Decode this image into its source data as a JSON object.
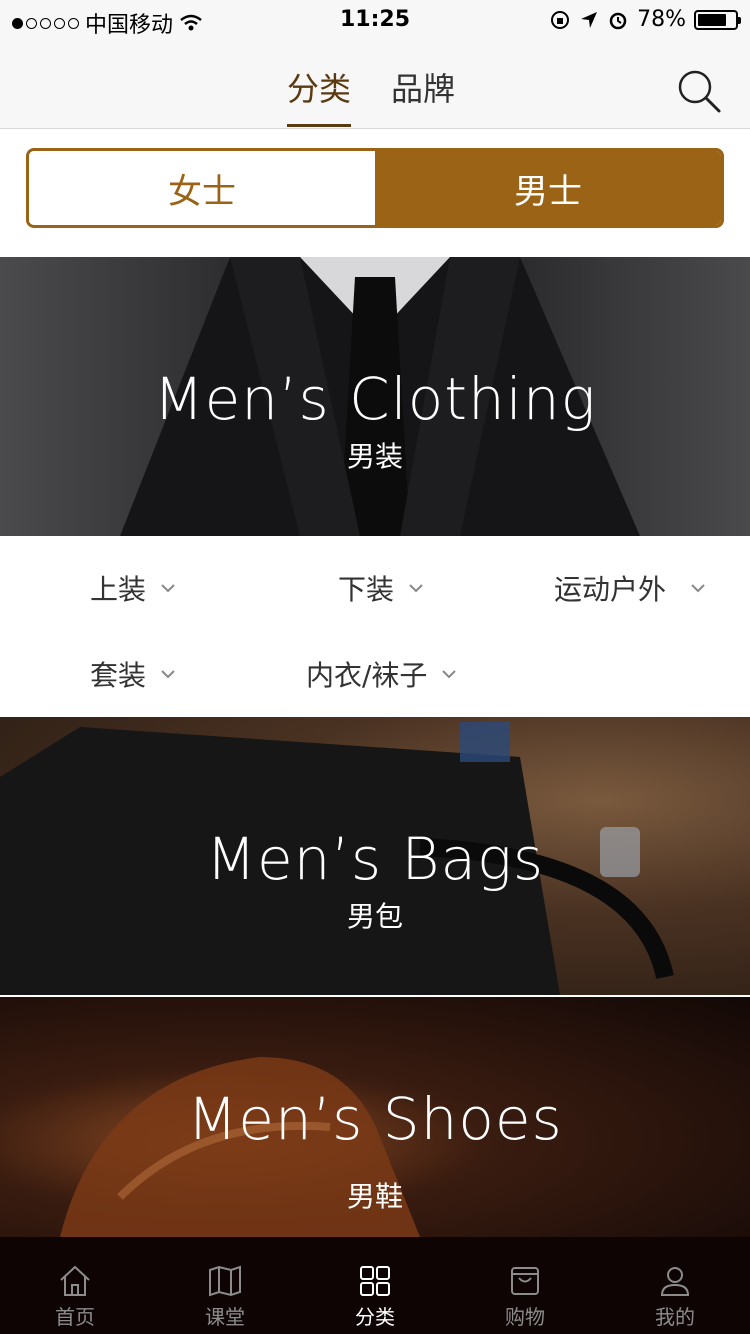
{
  "status_bar": {
    "carrier": "中国移动",
    "time": "11:25",
    "battery": "78%",
    "battery_level": 0.78
  },
  "top_nav": {
    "tabs": [
      {
        "label": "分类",
        "active": true
      },
      {
        "label": "品牌",
        "active": false
      }
    ],
    "search_icon": "search-icon"
  },
  "gender_toggle": {
    "options": [
      {
        "label": "女士",
        "active": false
      },
      {
        "label": "男士",
        "active": true
      }
    ]
  },
  "sections": {
    "clothing": {
      "title": "Men’s Clothing",
      "subtitle": "男装"
    },
    "bags": {
      "title": "Men’s Bags",
      "subtitle": "男包"
    },
    "shoes": {
      "title": "Men’s Shoes",
      "subtitle": "男鞋"
    }
  },
  "subcategories": [
    "上装",
    "下装",
    "运动户外",
    "套装",
    "内衣/袜子"
  ],
  "tab_bar": {
    "items": [
      {
        "label": "首页",
        "icon": "home-icon",
        "active": false
      },
      {
        "label": "课堂",
        "icon": "map-icon",
        "active": false
      },
      {
        "label": "分类",
        "icon": "grid-icon",
        "active": true
      },
      {
        "label": "购物",
        "icon": "bag-icon",
        "active": false
      },
      {
        "label": "我的",
        "icon": "user-icon",
        "active": false
      }
    ]
  },
  "colors": {
    "accent": "#9a6316",
    "tab_bar_bg": "#0e0404"
  }
}
